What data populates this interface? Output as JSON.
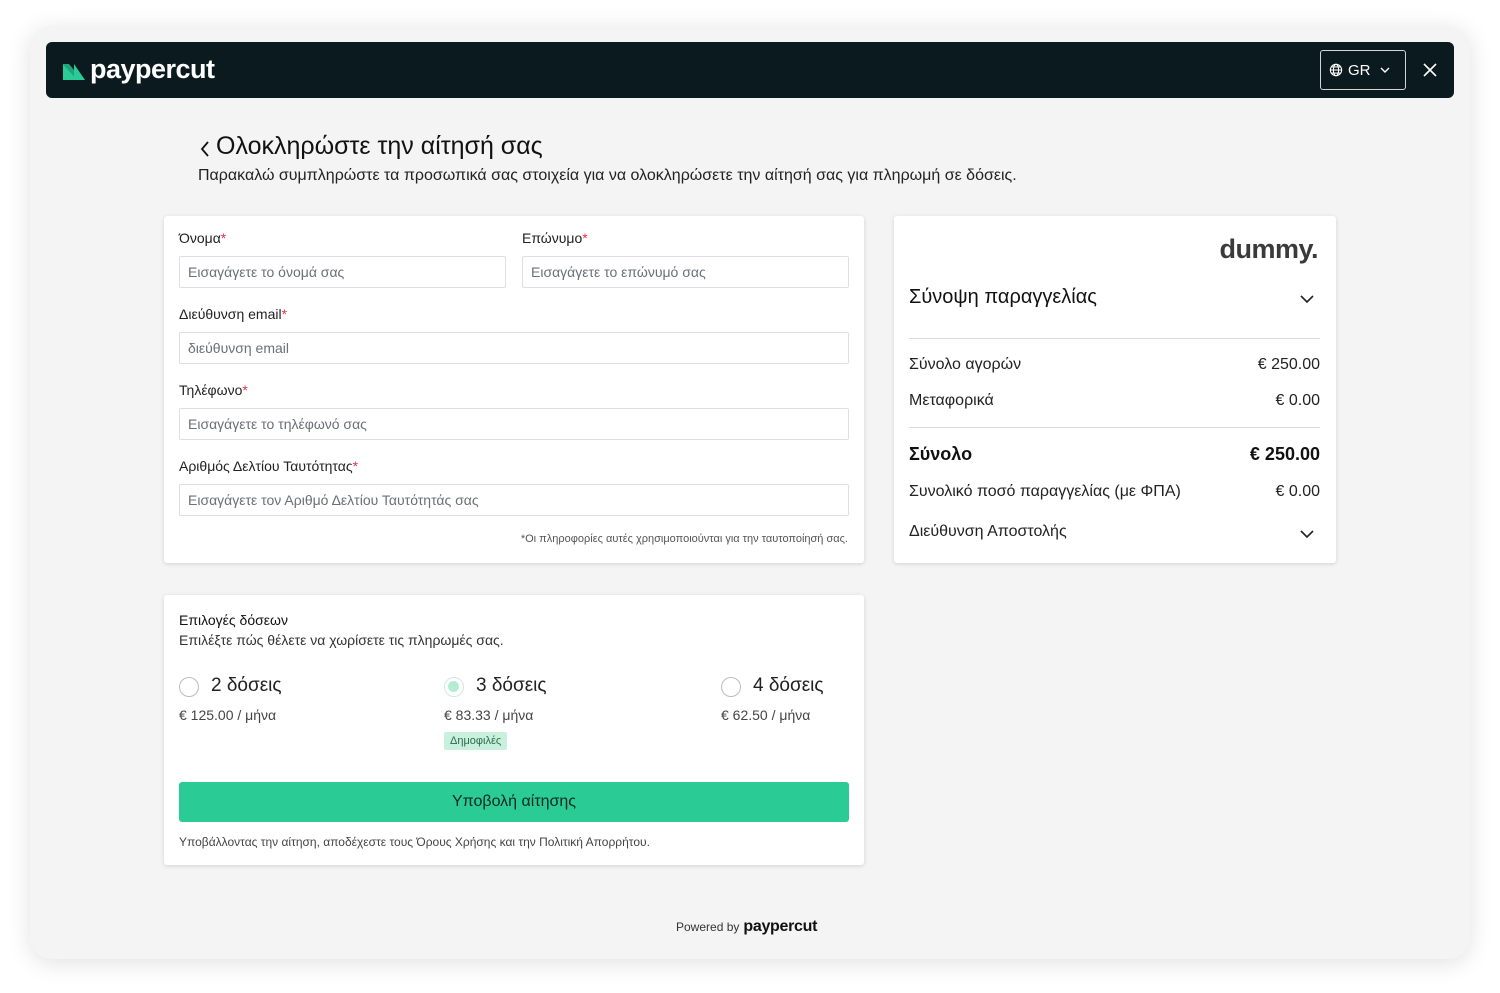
{
  "brand": {
    "name": "paypercut",
    "accent": "#2bcb96",
    "dark": "#0a1a1f"
  },
  "topbar": {
    "lang_label": "GR",
    "lang_icon": "globe-icon",
    "close_icon": "close-icon"
  },
  "page": {
    "title": "Ολοκληρώστε την αίτησή σας",
    "subtitle": "Παρακαλώ συμπληρώστε τα προσωπικά σας στοιχεία για να ολοκληρώσετε την αίτησή σας για πληρωμή σε δόσεις."
  },
  "form": {
    "first_name": {
      "label": "Όνομα",
      "placeholder": "Εισαγάγετε το όνομά σας"
    },
    "last_name": {
      "label": "Επώνυμο",
      "placeholder": "Εισαγάγετε το επώνυμό σας"
    },
    "email": {
      "label": "Διεύθυνση email",
      "placeholder": "διεύθυνση email"
    },
    "phone": {
      "label": "Τηλέφωνο",
      "placeholder": "Εισαγάγετε το τηλέφωνό σας"
    },
    "id_number": {
      "label": "Αριθμός Δελτίου Ταυτότητας",
      "placeholder": "Εισαγάγετε τον Αριθμό Δελτίου Ταυτότητάς σας"
    },
    "required_mark": "*",
    "note": "*Οι πληροφορίες αυτές χρησιμοποιούνται για την ταυτοποίησή σας."
  },
  "summary": {
    "merchant": "dummy.",
    "title": "Σύνοψη παραγγελίας",
    "purchases_label": "Σύνολο αγορών",
    "purchases_value": "€ 250.00",
    "shipping_label": "Μεταφορικά",
    "shipping_value": "€ 0.00",
    "total_label": "Σύνολο",
    "total_value": "€ 250.00",
    "vat_label": "Συνολικό ποσό παραγγελίας (με ΦΠΑ)",
    "vat_value": "€ 0.00",
    "address_label": "Διεύθυνση Αποστολής"
  },
  "installments": {
    "title": "Επιλογές δόσεων",
    "subtitle": "Επιλέξτε πώς θέλετε να χωρίσετε τις πληρωμές σας.",
    "options": [
      {
        "name": "2 δόσεις",
        "price": "€ 125.00 / μήνα",
        "selected": false,
        "badge": ""
      },
      {
        "name": "3 δόσεις",
        "price": "€ 83.33 / μήνα",
        "selected": true,
        "badge": "Δημοφιλές"
      },
      {
        "name": "4 δόσεις",
        "price": "€ 62.50 / μήνα",
        "selected": false,
        "badge": ""
      }
    ],
    "submit_label": "Υποβολή αίτησης",
    "terms": "Υποβάλλοντας την αίτηση, αποδέχεστε τους Όρους Χρήσης και την Πολιτική Απορρήτου."
  },
  "footer": {
    "powered_by": "Powered by",
    "brand": "paypercut"
  }
}
